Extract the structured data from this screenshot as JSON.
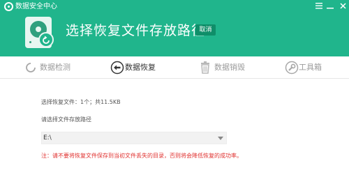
{
  "window": {
    "title": "数据安全中心",
    "controls": [
      "menu-icon",
      "minimize-icon",
      "close-icon"
    ]
  },
  "header": {
    "title": "选择恢复文件存放路径",
    "cancel_label": "取消",
    "icon": "hard-disk-restore-icon"
  },
  "tabs": [
    {
      "label": "数据检测",
      "icon": "scan-icon",
      "active": false
    },
    {
      "label": "数据恢复",
      "icon": "restore-arrow-icon",
      "active": true
    },
    {
      "label": "数据销毁",
      "icon": "trash-icon",
      "active": false
    },
    {
      "label": "工具箱",
      "icon": "wrench-icon",
      "active": false
    }
  ],
  "content": {
    "selected_info": "选择恢复文件：1个；共11.5KB",
    "path_label": "请选择文件存放路径",
    "path_value": "E:\\",
    "warning": "注：请不要将恢复文件保存到当初文件丢失的目录，否则将会降低恢复的成功率。"
  },
  "colors": {
    "header_bg": "#20b58c",
    "cancel_bg": "#0f8e69",
    "warning": "#e0312f",
    "tab_inactive": "#9a9a9a"
  }
}
